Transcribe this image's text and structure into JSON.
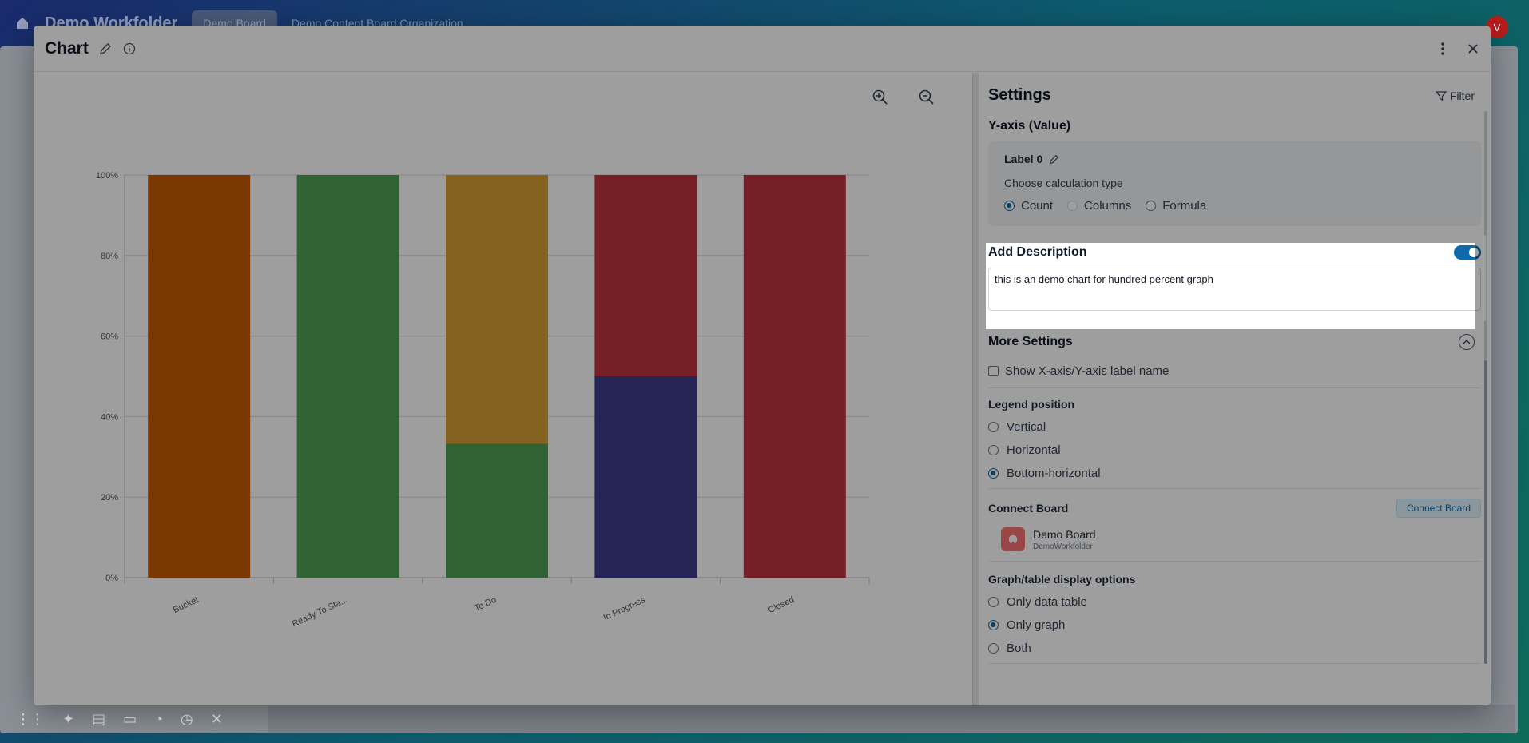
{
  "background": {
    "workspace_title": "Demo Workfolder",
    "active_tab": "Demo Board",
    "other_tabs": "Demo Content Board Organization",
    "avatar_initial": "V"
  },
  "modal": {
    "title": "Chart"
  },
  "chart_data": {
    "type": "bar",
    "stacked": "percent",
    "categories": [
      "Bucket",
      "Ready To Sta...",
      "To Do",
      "In Progress",
      "Closed"
    ],
    "series": [
      {
        "color": "#c55a00",
        "values": [
          100,
          0,
          0,
          0,
          0
        ]
      },
      {
        "color": "#4f9f54",
        "values": [
          0,
          100,
          33.3,
          0,
          0
        ]
      },
      {
        "color": "#d89e36",
        "values": [
          0,
          0,
          66.7,
          0,
          0
        ]
      },
      {
        "color": "#3b3a8c",
        "values": [
          0,
          0,
          0,
          50,
          0
        ]
      },
      {
        "color": "#c0323f",
        "values": [
          0,
          0,
          0,
          50,
          100
        ]
      }
    ],
    "yticks": [
      "0%",
      "20%",
      "40%",
      "60%",
      "80%",
      "100%"
    ],
    "ylim": [
      0,
      100
    ],
    "grid": true
  },
  "settings": {
    "title": "Settings",
    "filter_label": "Filter",
    "yaxis": {
      "section_title": "Y-axis (Value)",
      "label": "Label 0",
      "calc_title": "Choose calculation type",
      "options": [
        "Count",
        "Columns",
        "Formula"
      ],
      "selected": "Count"
    },
    "description": {
      "title": "Add Description",
      "enabled": true,
      "value": "this is an demo chart for hundred percent graph"
    },
    "more": {
      "title": "More Settings",
      "show_axis_label": "Show X-axis/Y-axis label name",
      "legend_title": "Legend position",
      "legend_options": [
        "Vertical",
        "Horizontal",
        "Bottom-horizontal"
      ],
      "legend_selected": "Bottom-horizontal",
      "connect_title": "Connect Board",
      "connect_button": "Connect Board",
      "board_name": "Demo Board",
      "board_folder": "DemoWorkfolder",
      "display_title": "Graph/table display options",
      "display_options": [
        "Only data table",
        "Only graph",
        "Both"
      ],
      "display_selected": "Only graph"
    }
  }
}
